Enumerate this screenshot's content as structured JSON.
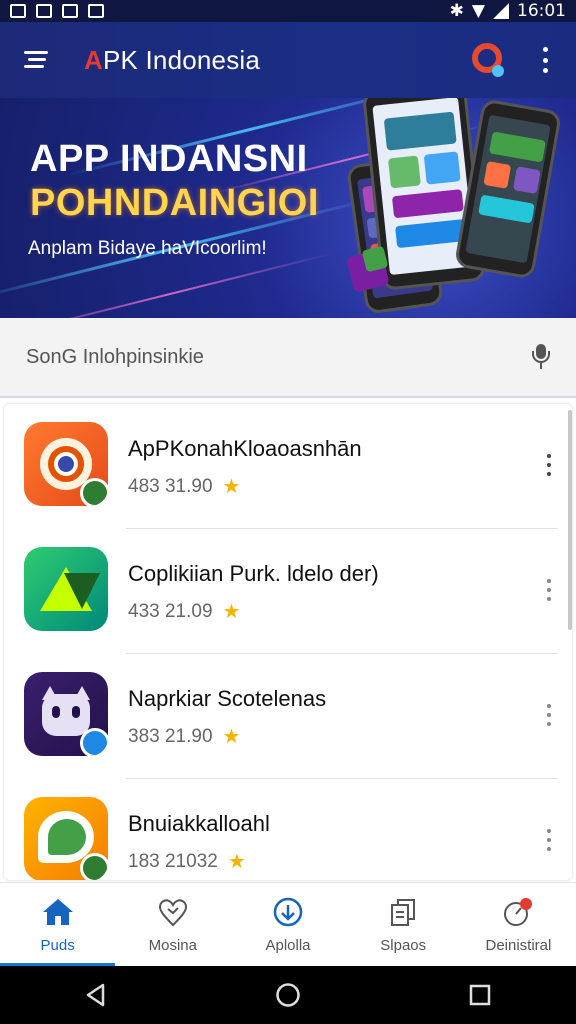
{
  "status_bar": {
    "time": "16:01"
  },
  "app_bar": {
    "title_accent": "A",
    "title_rest": "PK Indonesia"
  },
  "banner": {
    "headline_1": "APP INDANSNI",
    "headline_2": "POHNDAINGIOI",
    "subtitle": "Anplam Bidaye haVIcoorlim!"
  },
  "search": {
    "placeholder": "SonG Inlohpinsinkie"
  },
  "apps": [
    {
      "name": "ApPKonahKloaoasnhān",
      "rating": "483 31.90",
      "icon": "chrome-like-app-icon"
    },
    {
      "name": "Coplikiian Purk. ldelo der)",
      "rating": "433 21.09",
      "icon": "green-triangle-app-icon"
    },
    {
      "name": "Naprkiar Scotelenas",
      "rating": "383 21.90",
      "icon": "purple-cat-app-icon"
    },
    {
      "name": "Bnuiakkalloahl",
      "rating": "183 21032",
      "icon": "orange-green-app-icon"
    }
  ],
  "bottom_nav": [
    {
      "label": "Puds",
      "icon": "home-icon",
      "active": true
    },
    {
      "label": "Mosina",
      "icon": "location-heart-icon",
      "active": false
    },
    {
      "label": "Aplolla",
      "icon": "download-icon",
      "active": false
    },
    {
      "label": "Slpaos",
      "icon": "copy-icon",
      "active": false
    },
    {
      "label": "Deinistiral",
      "icon": "notification-compass-icon",
      "active": false
    }
  ],
  "colors": {
    "app_bar": "#1c2a78",
    "accent": "#e53935",
    "nav_active": "#1976d2",
    "star": "#f4b400"
  }
}
